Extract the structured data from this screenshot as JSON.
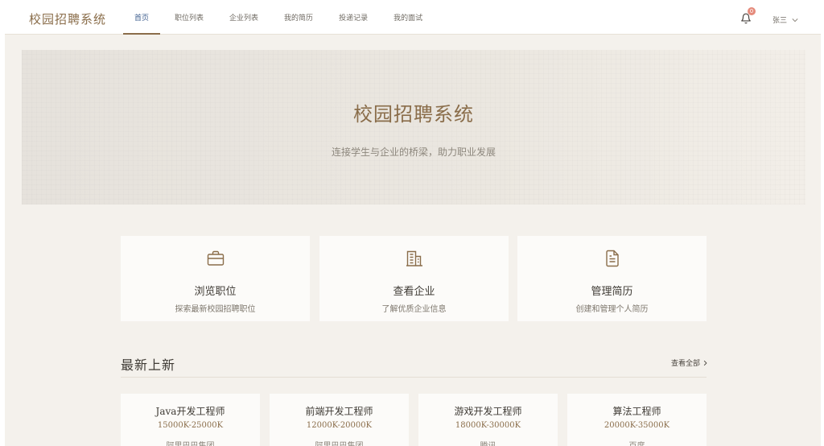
{
  "header": {
    "logo": "校园招聘系统",
    "nav": [
      {
        "label": "首页",
        "active": true
      },
      {
        "label": "职位列表",
        "active": false
      },
      {
        "label": "企业列表",
        "active": false
      },
      {
        "label": "我的简历",
        "active": false
      },
      {
        "label": "投递记录",
        "active": false
      },
      {
        "label": "我的面试",
        "active": false
      }
    ],
    "notification_icon": "bell-icon",
    "notification_count": "0",
    "user_name": "张三",
    "user_dropdown_icon": "chevron-down-icon"
  },
  "hero": {
    "title": "校园招聘系统",
    "subtitle": "连接学生与企业的桥梁，助力职业发展"
  },
  "features": [
    {
      "icon": "briefcase-icon",
      "title": "浏览职位",
      "desc": "探索最新校园招聘职位"
    },
    {
      "icon": "building-icon",
      "title": "查看企业",
      "desc": "了解优质企业信息"
    },
    {
      "icon": "document-icon",
      "title": "管理简历",
      "desc": "创建和管理个人简历"
    }
  ],
  "latest": {
    "title": "最新上新",
    "view_all": "查看全部"
  },
  "jobs": [
    {
      "title": "Java开发工程师",
      "salary": "15000K-25000K",
      "company": "阿里巴巴集团"
    },
    {
      "title": "前端开发工程师",
      "salary": "12000K-20000K",
      "company": "阿里巴巴集团"
    },
    {
      "title": "游戏开发工程师",
      "salary": "18000K-30000K",
      "company": "腾讯"
    },
    {
      "title": "算法工程师",
      "salary": "20000K-35000K",
      "company": "百度"
    }
  ],
  "colors": {
    "accent": "#8a6d4a",
    "active_nav": "#3f5f8f",
    "badge": "#e58a7b",
    "background": "#f4f1ec"
  }
}
